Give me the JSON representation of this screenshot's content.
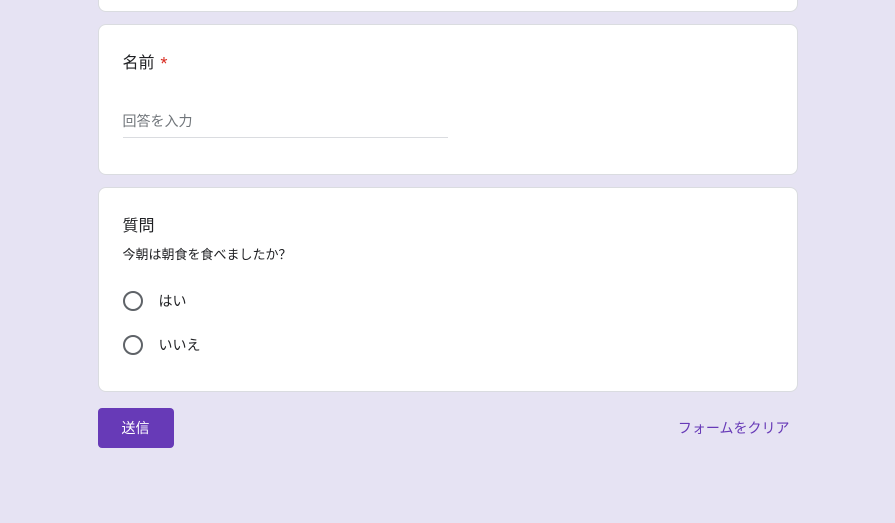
{
  "questions": [
    {
      "title": "名前",
      "required": true,
      "input": {
        "placeholder": "回答を入力",
        "value": ""
      }
    },
    {
      "title": "質問",
      "description": "今朝は朝食を食べましたか？",
      "options": [
        "はい",
        "いいえ"
      ]
    }
  ],
  "actions": {
    "submit": "送信",
    "clearForm": "フォームをクリア"
  }
}
